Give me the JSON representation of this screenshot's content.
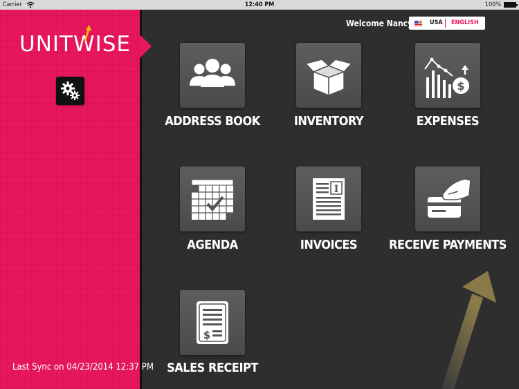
{
  "status_bar": {
    "carrier": "Carrier",
    "time": "12:40 PM",
    "battery": "100%"
  },
  "sidebar": {
    "logo": "UNITWISE",
    "last_sync": "Last Sync on 04/23/2014 12:37 PM"
  },
  "header": {
    "welcome": "Welcome Nancy!",
    "country": "USA",
    "language": "ENGLISH"
  },
  "menu": [
    {
      "label": "ADDRESS BOOK",
      "icon": "people-icon"
    },
    {
      "label": "INVENTORY",
      "icon": "box-icon"
    },
    {
      "label": "EXPENSES",
      "icon": "chart-dollar-icon"
    },
    {
      "label": "AGENDA",
      "icon": "calendar-icon"
    },
    {
      "label": "INVOICES",
      "icon": "document-icon"
    },
    {
      "label": "RECEIVE PAYMENTS",
      "icon": "card-payment-icon"
    },
    {
      "label": "SALES RECEIPT",
      "icon": "receipt-icon"
    }
  ],
  "colors": {
    "sidebar": "#e8175d",
    "content_background": "#2e2e2e",
    "tile": "#555555",
    "accent_arrow": "#8a7a4a"
  }
}
